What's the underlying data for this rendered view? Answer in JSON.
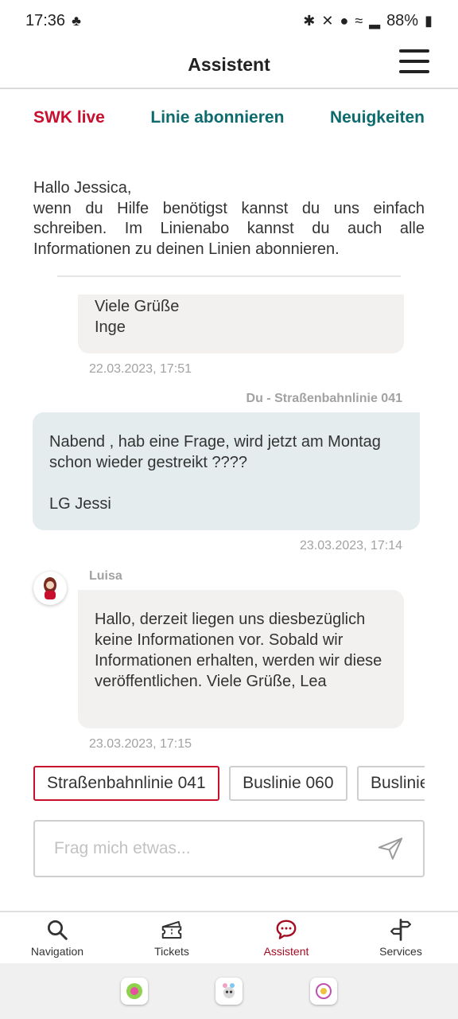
{
  "status": {
    "time": "17:36",
    "battery": "88%"
  },
  "appbar": {
    "title": "Assistent"
  },
  "subtabs": {
    "swk_live": "SWK live",
    "line_subscribe": "Linie abonnieren",
    "news": "Neuigkeiten"
  },
  "intro": "Hallo Jessica,\nwenn du Hilfe benötigst kannst du uns einfach schreiben. Im Linienabo kannst du auch alle Informationen zu deinen Linien abonnieren.",
  "messages": [
    {
      "text": "Viele Grüße\nInge",
      "time": "22.03.2023, 17:51"
    },
    {
      "sender": "Du - Straßenbahnlinie 041",
      "text": "Nabend , hab eine Frage,  wird jetzt am Montag schon wieder gestreikt ????\n\nLG Jessi",
      "time": "23.03.2023, 17:14"
    },
    {
      "sender": "Luisa",
      "text": "Hallo, derzeit liegen uns diesbezüglich keine Informationen vor. Sobald wir Informationen erhalten, werden wir diese veröffentlichen. Viele Grüße, Lea",
      "time": "23.03.2023, 17:15"
    }
  ],
  "chips": [
    "Straßenbahnlinie 041",
    "Buslinie 060",
    "Buslinie"
  ],
  "input": {
    "placeholder": "Frag mich etwas..."
  },
  "nav": [
    {
      "label": "Navigation",
      "icon": "search-icon"
    },
    {
      "label": "Tickets",
      "icon": "ticket-icon"
    },
    {
      "label": "Assistent",
      "icon": "chat-icon",
      "active": true
    },
    {
      "label": "Services",
      "icon": "signpost-icon"
    }
  ],
  "colors": {
    "brand_red": "#c8102e",
    "teal": "#0d6b6e",
    "bubble_in": "#f2f1ef",
    "bubble_out": "#e4ecee"
  }
}
